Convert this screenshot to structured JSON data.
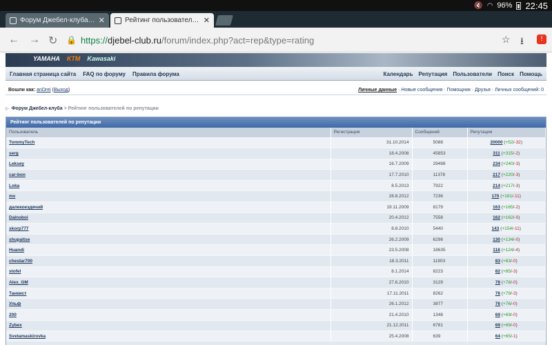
{
  "statusbar": {
    "battery": "96%",
    "time": "22:45"
  },
  "tabs": [
    {
      "label": "Форум Джебел-клуба -> Ф"
    },
    {
      "label": "Рейтинг пользователей г"
    }
  ],
  "address": {
    "scheme": "https://",
    "host": "djebel-club.ru",
    "path": "/forum/index.php?act=rep&type=rating"
  },
  "banner": {
    "logos": [
      "YAMAHA",
      "KTM",
      "Kawasaki"
    ]
  },
  "nav": {
    "left": [
      "Главная страница сайта",
      "FAQ по форуму",
      "Правила форума"
    ],
    "right": [
      "Календарь",
      "Репутация",
      "Пользователи",
      "Поиск",
      "Помощь"
    ]
  },
  "userbar": {
    "logged_in_label": "Вошли как:",
    "username": "anDrei",
    "logout": "Выход",
    "links": [
      "Личные данные",
      "Новые сообщения",
      "Помощник",
      "Друзья",
      "Личных сообщений: 0"
    ]
  },
  "breadcrumb": {
    "forum": "Форум Джебел-клуба",
    "separator": ">",
    "current": "Рейтинг пользователей по репутации"
  },
  "table": {
    "title": "Рейтинг пользователей по репутации",
    "headers": [
      "Пользователь",
      "Регистрация",
      "Сообщений",
      "Репутация"
    ],
    "rows": [
      {
        "user": "TommyTech",
        "reg": "31.10.2014",
        "posts": "5088",
        "total": "20000",
        "plus": "+52",
        "minus": "-32"
      },
      {
        "user": "serg",
        "reg": "18.4.2008",
        "posts": "45853",
        "total": "311",
        "plus": "+315",
        "minus": "-2"
      },
      {
        "user": "Leksey",
        "reg": "16.7.2009",
        "posts": "29498",
        "total": "234",
        "plus": "+240",
        "minus": "-3"
      },
      {
        "user": "car-bon",
        "reg": "17.7.2010",
        "posts": "11378",
        "total": "217",
        "plus": "+220",
        "minus": "-3"
      },
      {
        "user": "Loka",
        "reg": "8.5.2013",
        "posts": "7922",
        "total": "214",
        "plus": "+217",
        "minus": "-3"
      },
      {
        "user": "mv",
        "reg": "28.8.2012",
        "posts": "7236",
        "total": "170",
        "plus": "+181",
        "minus": "-11"
      },
      {
        "user": "далекоездячий",
        "reg": "19.11.2009",
        "posts": "8179",
        "total": "163",
        "plus": "+165",
        "minus": "-2"
      },
      {
        "user": "Dalnoboi",
        "reg": "20.4.2012",
        "posts": "7558",
        "total": "162",
        "plus": "+162",
        "minus": "-0"
      },
      {
        "user": "skorp777",
        "reg": "8.8.2010",
        "posts": "5440",
        "total": "143",
        "plus": "+154",
        "minus": "-11"
      },
      {
        "user": "shupaltse",
        "reg": "26.2.2009",
        "posts": "6296",
        "total": "130",
        "plus": "+134",
        "minus": "-0"
      },
      {
        "user": "Huandi",
        "reg": "23.5.2008",
        "posts": "18635",
        "total": "118",
        "plus": "+124",
        "minus": "-4"
      },
      {
        "user": "chestar700",
        "reg": "18.3.2011",
        "posts": "11903",
        "total": "83",
        "plus": "+83",
        "minus": "-0"
      },
      {
        "user": "stofel",
        "reg": "8.1.2014",
        "posts": "8223",
        "total": "82",
        "plus": "+85",
        "minus": "-3"
      },
      {
        "user": "Alex_GM",
        "reg": "27.6.2010",
        "posts": "3129",
        "total": "78",
        "plus": "+78",
        "minus": "-0"
      },
      {
        "user": "Танкист",
        "reg": "17.11.2011",
        "posts": "8262",
        "total": "76",
        "plus": "+79",
        "minus": "-3"
      },
      {
        "user": "Ульф",
        "reg": "26.1.2012",
        "posts": "3877",
        "total": "76",
        "plus": "+76",
        "minus": "-0"
      },
      {
        "user": "200",
        "reg": "21.4.2010",
        "posts": "1348",
        "total": "69",
        "plus": "+69",
        "minus": "-0"
      },
      {
        "user": "Zybex",
        "reg": "21.12.2011",
        "posts": "6781",
        "total": "69",
        "plus": "+69",
        "minus": "-0"
      },
      {
        "user": "Svetamaskirovka",
        "reg": "25.4.2008",
        "posts": "639",
        "total": "64",
        "plus": "+65",
        "minus": "-1"
      }
    ]
  }
}
